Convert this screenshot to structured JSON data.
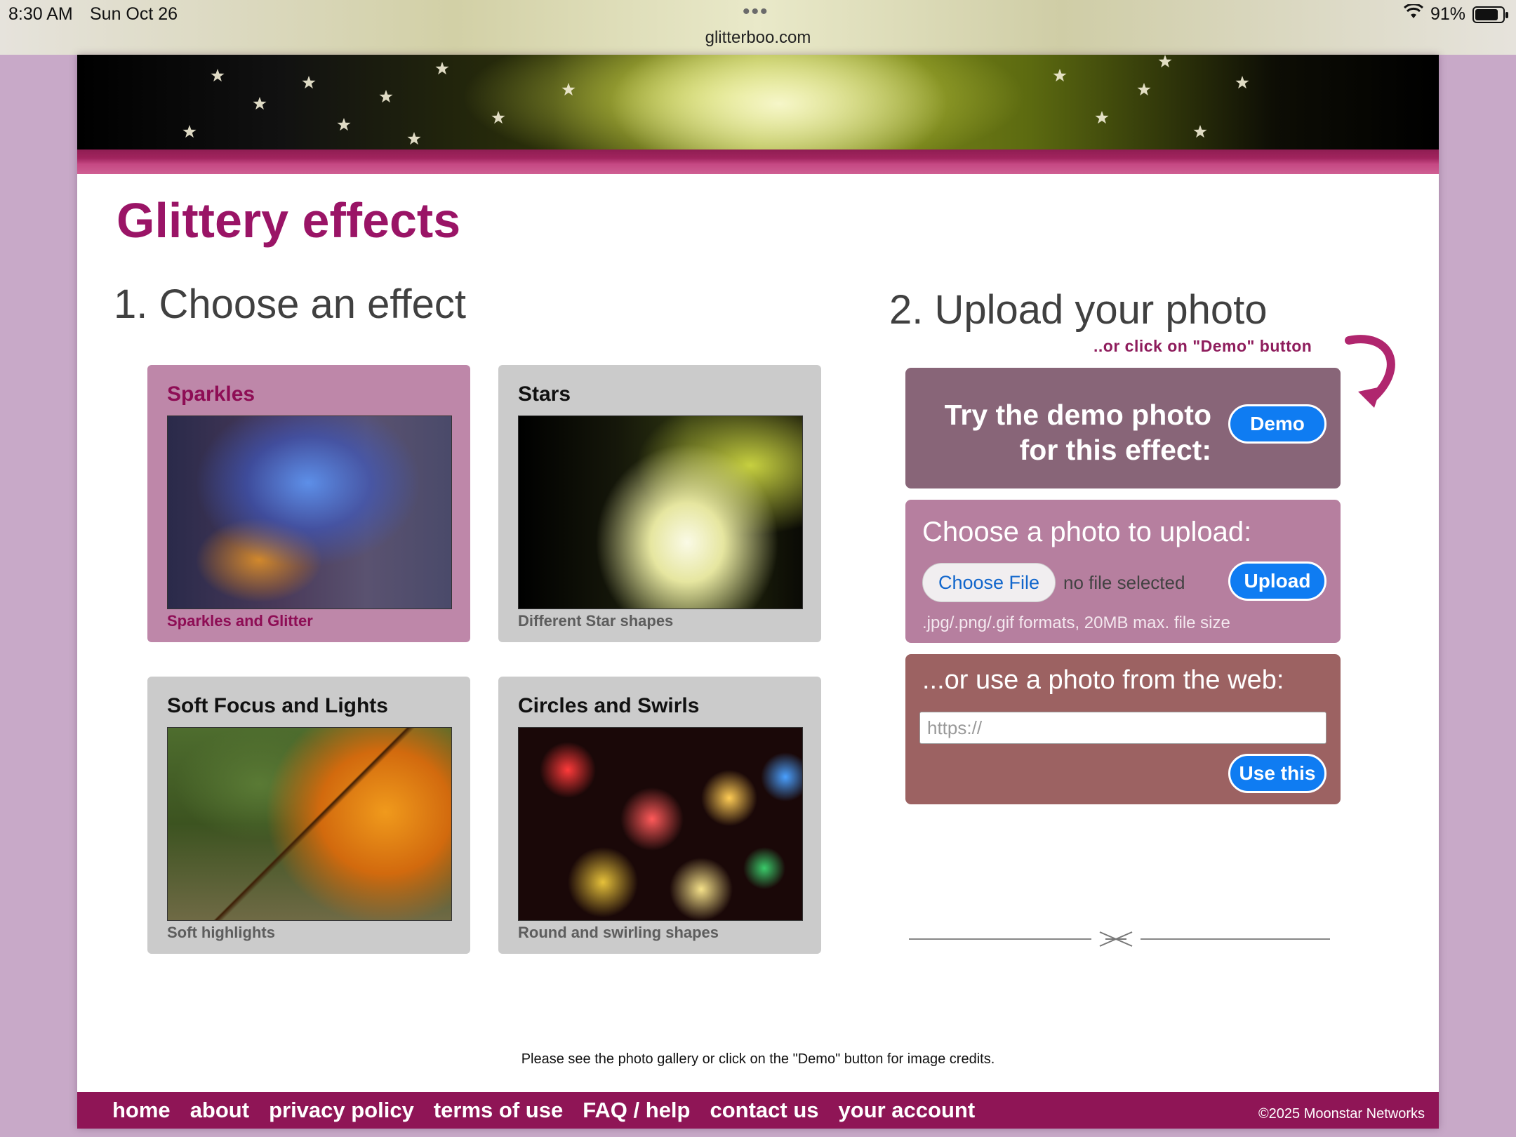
{
  "status_bar": {
    "time": "8:30 AM",
    "date": "Sun Oct 26",
    "url": "glitterboo.com",
    "battery_percent": "91%",
    "battery_level": 0.91,
    "wifi_icon": "wifi-icon"
  },
  "page": {
    "title": "Glittery effects",
    "step1_heading": "1. Choose an effect",
    "step2_heading": "2. Upload your photo",
    "demo_hint": "..or click on \"Demo\" button"
  },
  "effects": [
    {
      "title": "Sparkles",
      "description": "Sparkles and Glitter",
      "selected": true
    },
    {
      "title": "Stars",
      "description": "Different Star shapes",
      "selected": false
    },
    {
      "title": "Soft Focus and Lights",
      "description": "Soft highlights",
      "selected": false
    },
    {
      "title": "Circles and Swirls",
      "description": "Round and swirling shapes",
      "selected": false
    }
  ],
  "demo_panel": {
    "line1": "Try the demo photo",
    "line2": "for this effect:",
    "button_label": "Demo"
  },
  "upload_panel": {
    "title": "Choose a photo to upload:",
    "choose_file_label": "Choose File",
    "file_status": "no file selected",
    "upload_label": "Upload",
    "format_note": ".jpg/.png/.gif formats, 20MB max. file size"
  },
  "web_panel": {
    "title": "...or use a photo from the web:",
    "input_placeholder": "https://",
    "input_value": "",
    "button_label": "Use this"
  },
  "credits": "Please see the photo gallery or click on the \"Demo\" button for image credits.",
  "footer": {
    "links": [
      "home",
      "about",
      "privacy policy",
      "terms of use",
      "FAQ / help",
      "contact us",
      "your account"
    ],
    "copyright": "©2025 Moonstar Networks"
  },
  "colors": {
    "brand_magenta": "#9a1466",
    "footer_bg": "#8f1556",
    "button_blue": "#0f7cf2",
    "selected_card": "#be87a9"
  }
}
